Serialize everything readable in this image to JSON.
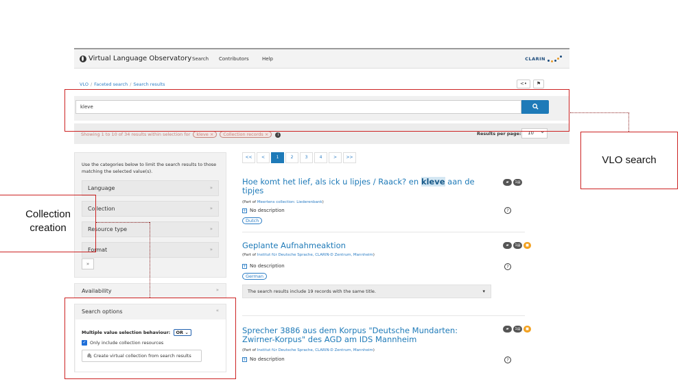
{
  "topnav": {
    "title": "Virtual Language Observatory",
    "items": [
      "Search",
      "Contributors",
      "Help"
    ],
    "logo_text": "CLARIN"
  },
  "breadcrumb": {
    "items": [
      "VLO",
      "Faceted search",
      "Search results"
    ],
    "share_label": "<•",
    "flag_label": "⚑"
  },
  "search": {
    "value": "kleve",
    "button_icon": "search-icon"
  },
  "status": {
    "text": "Showing 1 to 10 of 34 results within selection for",
    "chips": [
      "kleve ×",
      "Collection records ×"
    ],
    "rpp_label": "Results per page:",
    "rpp_value": "10"
  },
  "facets": {
    "intro": "Use the categories below to limit the search results to those matching the selected value(s).",
    "items": [
      "Language",
      "Collection",
      "Resource type",
      "Format"
    ],
    "more_label": "»"
  },
  "availability": {
    "label": "Availability"
  },
  "search_options": {
    "label": "Search options",
    "mvb_label": "Multiple value selection behaviour:",
    "mvb_value": "OR",
    "checkbox_label": "Only include collection resources",
    "vc_button": "Create virtual collection from search results"
  },
  "pager": {
    "items": [
      "<<",
      "<",
      "1",
      "2",
      "3",
      "4",
      ">",
      ">>"
    ],
    "active": "1"
  },
  "records": [
    {
      "title_pre": "Hoe komt het lief, als ick u lipjes / Raack? en ",
      "title_hl": "kleve",
      "title_post": " aan de tipjes",
      "part_prefix": "(Part of ",
      "part_link": "Meertens collection: Liederenbank",
      "part_suffix": ")",
      "desc": "No description",
      "lang": "Dutch"
    },
    {
      "title": "Geplante Aufnahmeaktion",
      "part_prefix": "(Part of ",
      "part_link": "Institut für Deutsche Sprache, CLARIN-D Zentrum, Mannheim",
      "part_suffix": ")",
      "desc": "No description",
      "lang": "German",
      "same_title": "The search results include 19 records with the same title."
    },
    {
      "title": "Sprecher 3886 aus dem Korpus \"Deutsche Mundarten: Zwirner-Korpus\" des AGD am IDS Mannheim",
      "part_prefix": "(Part of ",
      "part_link": "Institut für Deutsche Sprache, CLARIN-D Zentrum, Mannheim",
      "part_suffix": ")",
      "desc": "No description"
    }
  ],
  "annotations": {
    "vlo_search": "VLO search",
    "collection_creation": "Collection creation"
  }
}
